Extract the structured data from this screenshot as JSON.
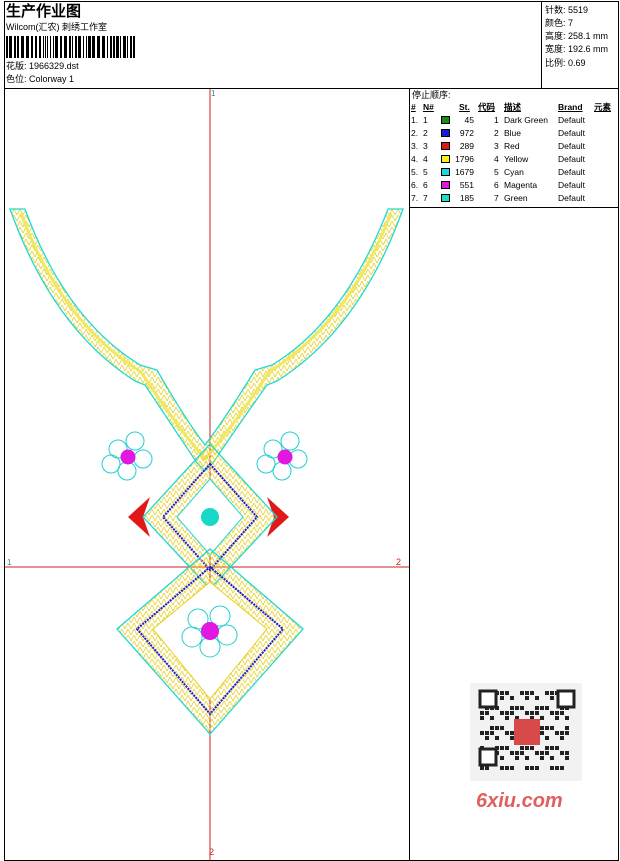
{
  "header": {
    "title": "生产作业图",
    "company": "Wilcom(汇农) 刺绣工作室",
    "design_label": "花版:",
    "design_value": "1966329.dst",
    "colorway_label": "色位:",
    "colorway_value": "Colorway 1"
  },
  "stats": [
    {
      "label": "针数:",
      "value": "5519"
    },
    {
      "label": "颜色:",
      "value": "7"
    },
    {
      "label": "高度:",
      "value": "258.1 mm"
    },
    {
      "label": "宽度:",
      "value": "192.6 mm"
    },
    {
      "label": "比例:",
      "value": "0.69"
    }
  ],
  "stop_sequence": {
    "title": "停止顺序:",
    "headers": {
      "hash": "#",
      "n": "N#",
      "st": "St.",
      "code": "代码",
      "desc": "描述",
      "brand": "Brand",
      "elem": "元素"
    },
    "rows": [
      {
        "num": "1.",
        "n": "1",
        "color": "#1a8a1a",
        "st": "45",
        "code": "1",
        "desc": "Dark Green",
        "brand": "Default"
      },
      {
        "num": "2.",
        "n": "2",
        "color": "#1c1cd8",
        "st": "972",
        "code": "2",
        "desc": "Blue",
        "brand": "Default"
      },
      {
        "num": "3.",
        "n": "3",
        "color": "#e01818",
        "st": "289",
        "code": "3",
        "desc": "Red",
        "brand": "Default"
      },
      {
        "num": "4.",
        "n": "4",
        "color": "#f4f418",
        "st": "1796",
        "code": "4",
        "desc": "Yellow",
        "brand": "Default"
      },
      {
        "num": "5.",
        "n": "5",
        "color": "#18d8d8",
        "st": "1679",
        "code": "5",
        "desc": "Cyan",
        "brand": "Default"
      },
      {
        "num": "6.",
        "n": "6",
        "color": "#e018e0",
        "st": "551",
        "code": "6",
        "desc": "Magenta",
        "brand": "Default"
      },
      {
        "num": "7.",
        "n": "7",
        "color": "#18e0c8",
        "st": "185",
        "code": "7",
        "desc": "Green",
        "brand": "Default"
      }
    ]
  },
  "axis_markers": {
    "top": "1",
    "left": "1",
    "right": "2",
    "bottom": "2"
  },
  "watermark": "6xiu.com"
}
